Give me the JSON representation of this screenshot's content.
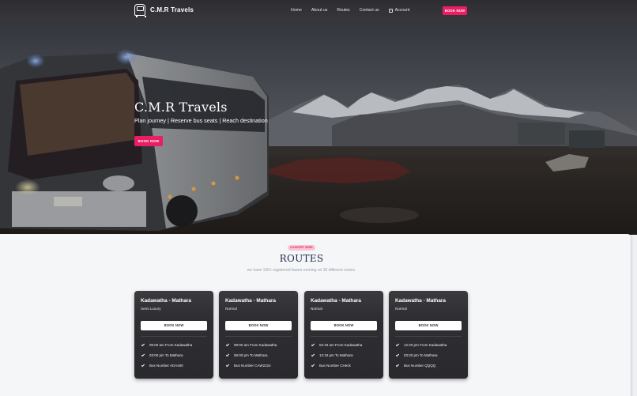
{
  "nav": {
    "brand": "C.M.R Travels",
    "links": [
      "Home",
      "About us",
      "Routes",
      "Contact us"
    ],
    "account": "Account",
    "book_now": "BOOK NOW"
  },
  "hero": {
    "title": "C.M.R Travels",
    "subtitle": "Plan journey | Reserve bus seats | Reach destination",
    "book_now": "BOOK NOW"
  },
  "routes": {
    "badge": "COUNTRY WIDE",
    "title": "ROUTES",
    "subtitle": "we have 100+ registered buses running on 30 different routes.",
    "cards": [
      {
        "title": "Kadawatha - Mathara",
        "type": "Semi Luxury",
        "button": "BOOK NOW",
        "depart": "05:00 am From Kadawatha",
        "arrive": "03:00 pm To Mathara",
        "bus": "Bus Number ADA400"
      },
      {
        "title": "Kadawatha - Mathara",
        "type": "Normal",
        "button": "BOOK NOW",
        "depart": "09:00 am From Kadawatha",
        "arrive": "06:00 pm To Mathara",
        "bus": "Bus Number CAW2224"
      },
      {
        "title": "Kadawatha - Mathara",
        "type": "Normal",
        "button": "BOOK NOW",
        "depart": "02:19 am From Kadawatha",
        "arrive": "12:19 pm To Mathara",
        "bus": "Bus Number CHeck"
      },
      {
        "title": "Kadawatha - Mathara",
        "type": "Normal",
        "button": "BOOK NOW",
        "depart": "12:20 pm From Kadawatha",
        "arrive": "03:20 pm To Mathara",
        "bus": "Bus Number QQQQ"
      }
    ]
  },
  "colors": {
    "accent": "#e91e63",
    "navbar": "#333337",
    "card": "#2f2f33",
    "title": "#1e2a4a"
  }
}
